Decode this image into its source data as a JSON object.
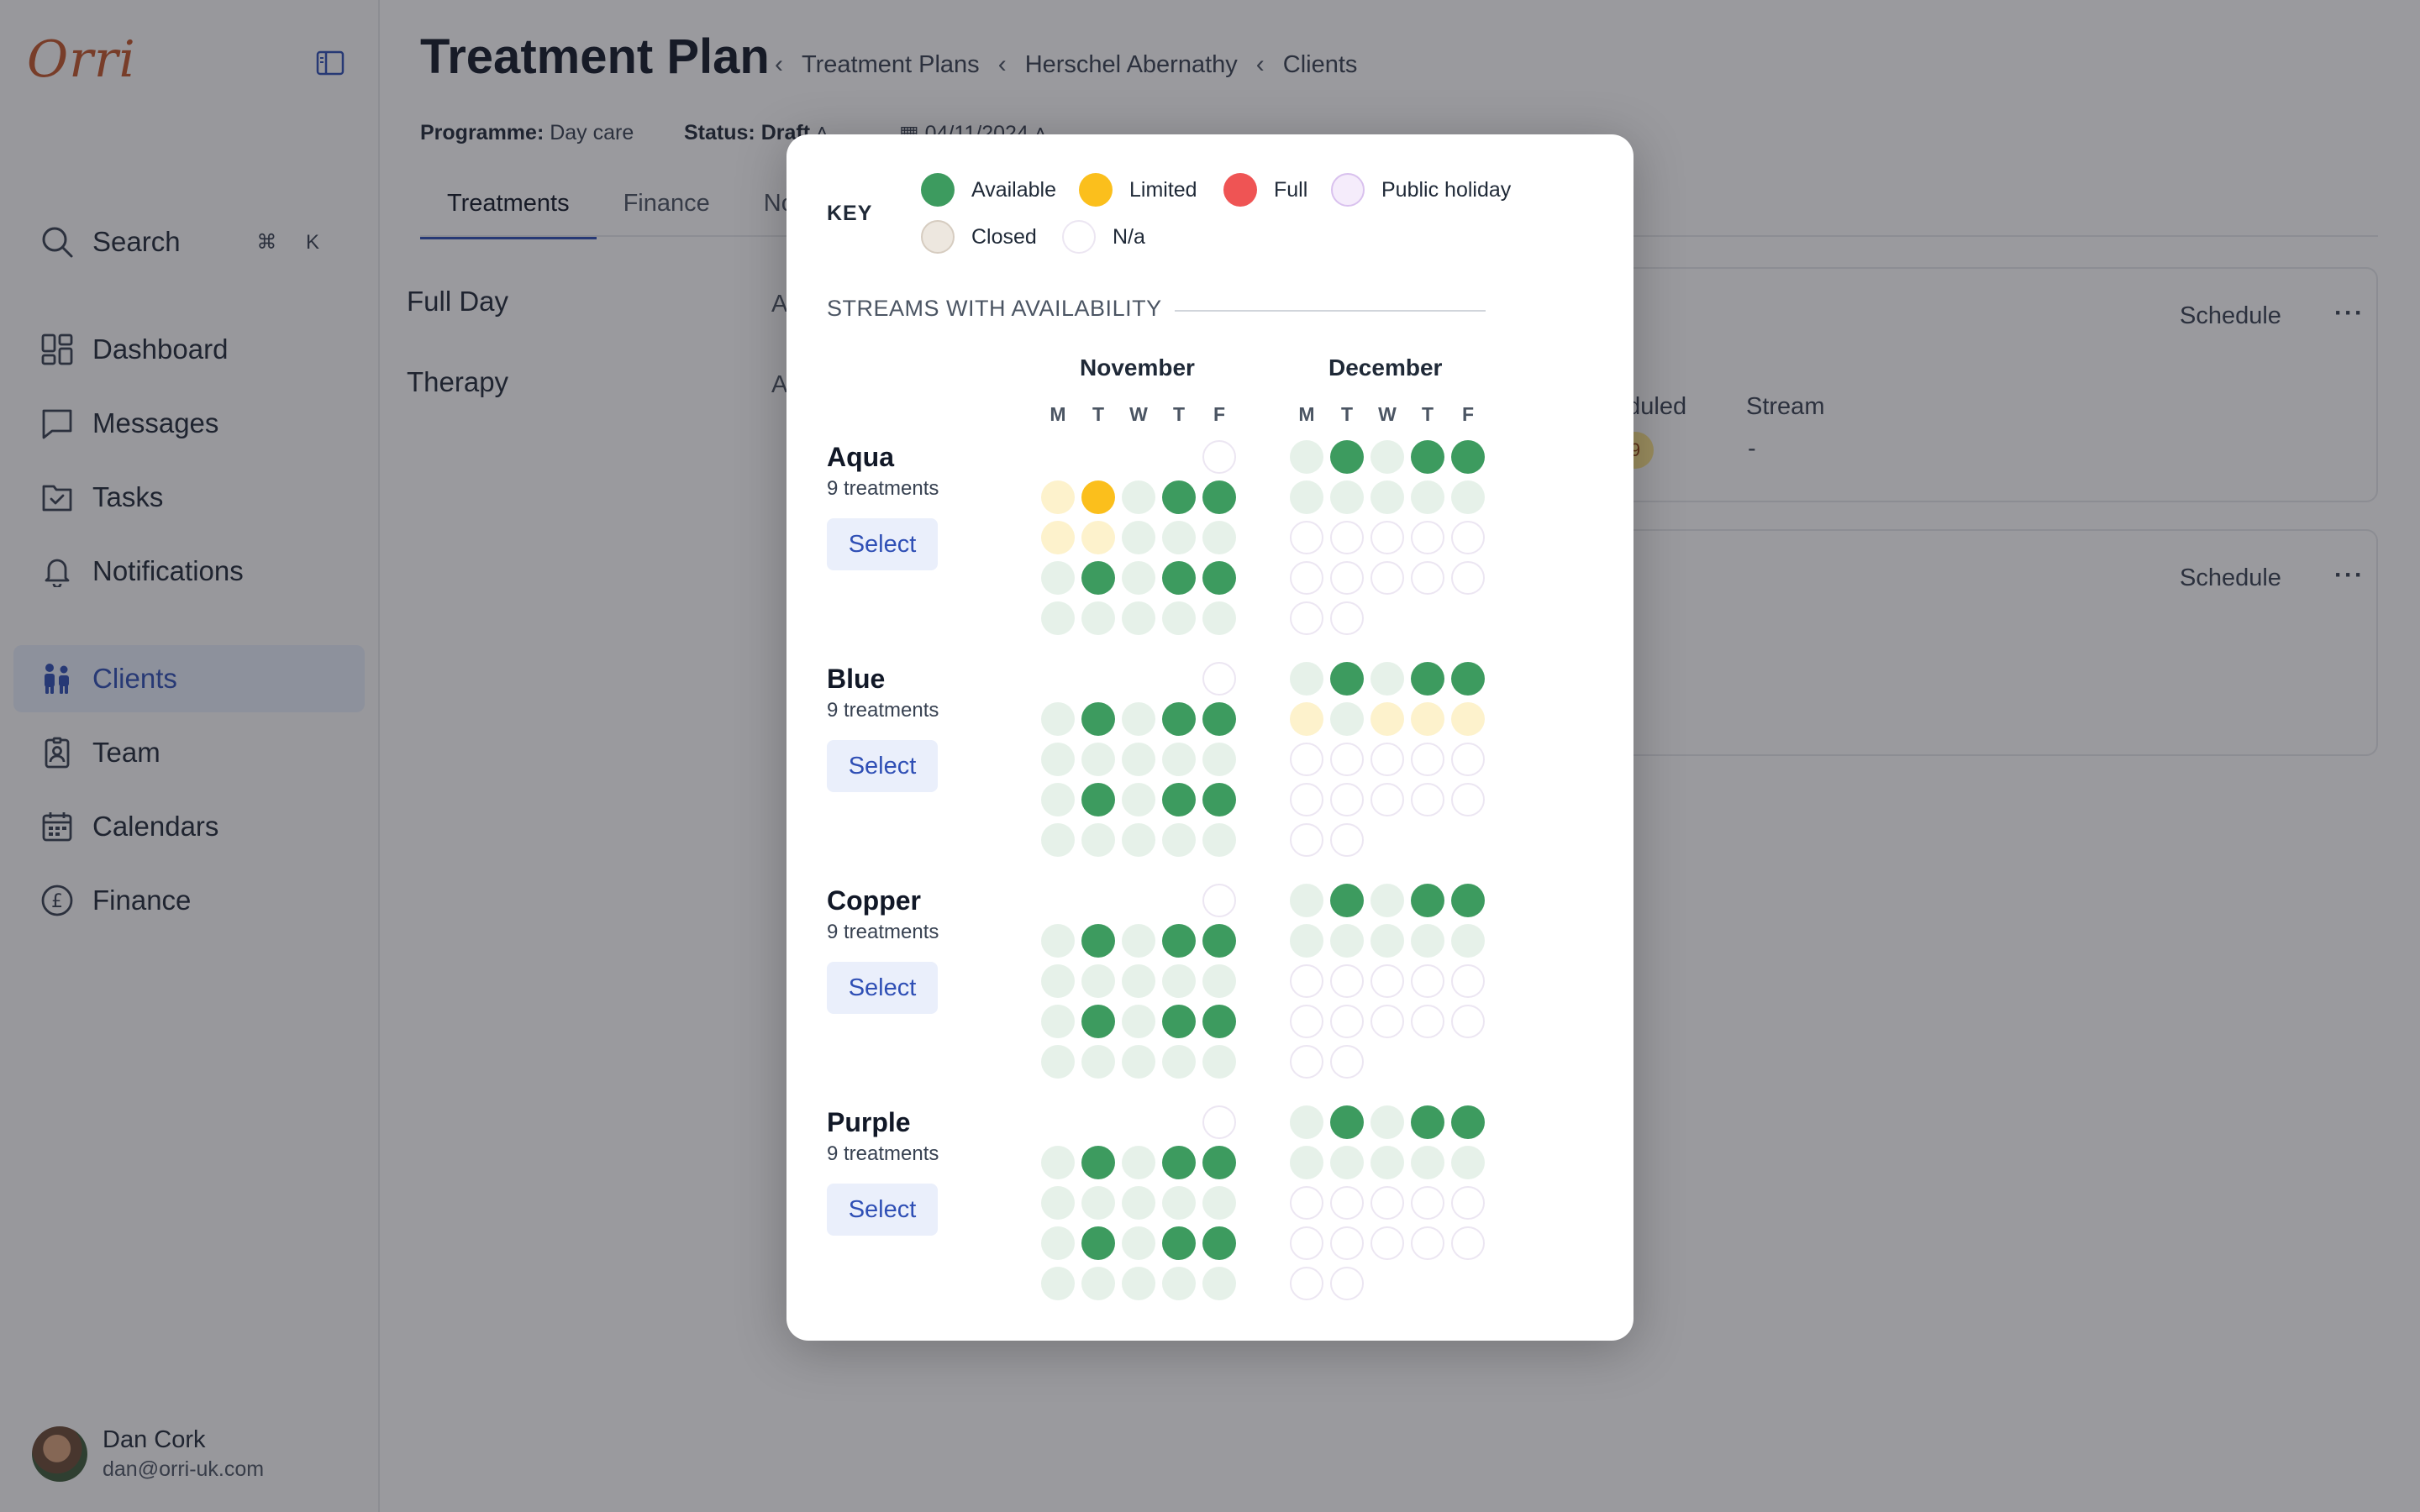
{
  "app": {
    "logo_text": "Orri"
  },
  "sidebar": {
    "search_label": "Search",
    "search_shortcut": "⌘ K",
    "items": [
      {
        "label": "Dashboard",
        "icon": "dashboard-icon"
      },
      {
        "label": "Messages",
        "icon": "messages-icon"
      },
      {
        "label": "Tasks",
        "icon": "tasks-icon"
      },
      {
        "label": "Notifications",
        "icon": "bell-icon"
      },
      {
        "label": "Clients",
        "icon": "clients-icon",
        "active": true
      },
      {
        "label": "Team",
        "icon": "team-icon"
      },
      {
        "label": "Calendars",
        "icon": "calendar-icon"
      },
      {
        "label": "Finance",
        "icon": "pound-icon"
      }
    ],
    "user": {
      "name": "Dan Cork",
      "email": "dan@orri-uk.com"
    }
  },
  "header": {
    "title": "Treatment Plan",
    "breadcrumbs": [
      "Treatment Plans",
      "Herschel Abernathy",
      "Clients"
    ],
    "programme_label": "Programme:",
    "programme_value": "Day care",
    "status_label": "Status:",
    "status_value": "Draft",
    "date_value": "04/11/2024"
  },
  "tabs": [
    "Treatments",
    "Finance",
    "No"
  ],
  "plan_items": [
    "Full Day",
    "Therapy"
  ],
  "plan_item_prefix": "A",
  "cards": {
    "schedule_label": "Schedule",
    "more_label": "···",
    "col_scheduled": "eduled",
    "col_stream": "Stream",
    "scheduled_value": "9",
    "stream_value": "-"
  },
  "modal": {
    "key_title": "KEY",
    "legend": [
      {
        "label": "Available",
        "code": "A"
      },
      {
        "label": "Limited",
        "code": "L"
      },
      {
        "label": "Full",
        "code": "F"
      },
      {
        "label": "Public holiday",
        "code": "P"
      },
      {
        "label": "Closed",
        "code": "C"
      },
      {
        "label": "N/a",
        "code": "N"
      }
    ],
    "section_title": "STREAMS WITH AVAILABILITY",
    "months": [
      "November",
      "December"
    ],
    "weekdays": [
      "M",
      "T",
      "W",
      "T",
      "F"
    ],
    "colors": {
      "available": "#3d9b5f",
      "limited": "#fbbf1c",
      "full": "#ef5454",
      "public_holiday": "#f5ecfb",
      "closed": "#ede7df",
      "na": "#ffffff"
    },
    "streams": [
      {
        "name": "Aqua",
        "count": "9 treatments",
        "button": "Select",
        "november": [
          ". . . . N",
          "l L a A A",
          "l l a a a",
          "a A a A A",
          "a a a a a"
        ],
        "december": [
          "a A a A A",
          "a a a a a",
          "N N N N N",
          "N N N N N",
          "N N . . ."
        ]
      },
      {
        "name": "Blue",
        "count": "9 treatments",
        "button": "Select",
        "november": [
          ". . . . N",
          "a A a A A",
          "a a a a a",
          "a A a A A",
          "a a a a a"
        ],
        "december": [
          "a A a A A",
          "l a l l l",
          "N N N N N",
          "N N N N N",
          "N N . . ."
        ]
      },
      {
        "name": "Copper",
        "count": "9 treatments",
        "button": "Select",
        "november": [
          ". . . . N",
          "a A a A A",
          "a a a a a",
          "a A a A A",
          "a a a a a"
        ],
        "december": [
          "a A a A A",
          "a a a a a",
          "N N N N N",
          "N N N N N",
          "N N . . ."
        ]
      },
      {
        "name": "Purple",
        "count": "9 treatments",
        "button": "Select",
        "november": [
          ". . . . N",
          "a A a A A",
          "a a a a a",
          "a A a A A",
          "a a a a a"
        ],
        "december": [
          "a A a A A",
          "a a a a a",
          "N N N N N",
          "N N N N N",
          "N N . . ."
        ]
      }
    ]
  }
}
